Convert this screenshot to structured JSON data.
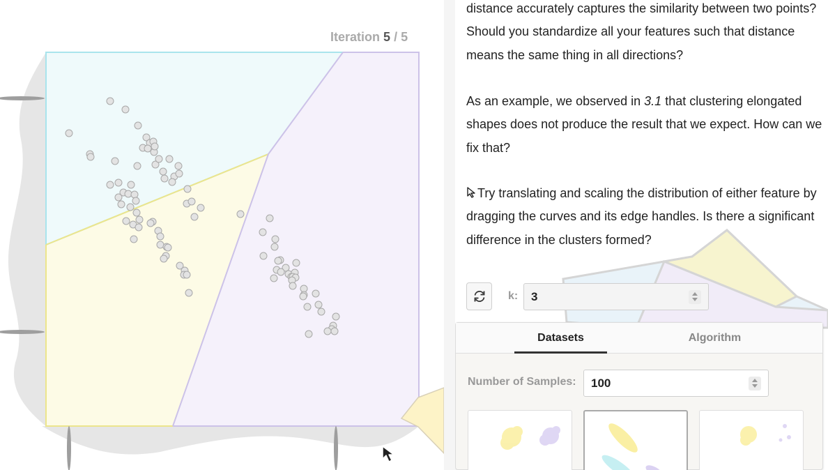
{
  "iteration": {
    "prefix": "Iteration",
    "current": "5",
    "separator": "/",
    "total": "5"
  },
  "article": {
    "para1": "distance accurately captures the similarity between two points? Should you standardize all your features such that distance means the same thing in all directions?",
    "para2_before": "As an example, we observed in",
    "para2_ref": "3.1",
    "para2_after": "that clustering elongated shapes does not produce the result that we expect. How can we fix that?",
    "para3": "Try translating and scaling the distribution of either feature by dragging the curves and its edge handles. Is there a significant difference in the clusters formed?"
  },
  "controls": {
    "k_label": "k:",
    "k_value": "3"
  },
  "tabs": [
    {
      "label": "Datasets"
    },
    {
      "label": "Algorithm"
    }
  ],
  "datasets_panel": {
    "samples_label": "Number of Samples:",
    "samples_value": "100"
  },
  "clusters": [
    {
      "name": "cyan",
      "fill": "#effafb",
      "stroke": "#a9e4ec"
    },
    {
      "name": "yellow",
      "fill": "#fdfbe6",
      "stroke": "#ece58c"
    },
    {
      "name": "lavender",
      "fill": "#f5f1fb",
      "stroke": "#ccc2e8"
    }
  ],
  "colors": {
    "point_fill": "#e3e3e3",
    "point_stroke": "#a8a8a8",
    "density_fill": "#e6e6e6",
    "accent_dark": "#333333"
  },
  "icons": {
    "refresh": "refresh-icon",
    "cursor": "cursor-icon"
  },
  "samples": [
    [
      158,
      145
    ],
    [
      180,
      157
    ],
    [
      99,
      191
    ],
    [
      198,
      180
    ],
    [
      129,
      221
    ],
    [
      130,
      225
    ],
    [
      210,
      197
    ],
    [
      215,
      205
    ],
    [
      220,
      203
    ],
    [
      205,
      212
    ],
    [
      212,
      213
    ],
    [
      221,
      218
    ],
    [
      222,
      210
    ],
    [
      165,
      231
    ],
    [
      197,
      238
    ],
    [
      223,
      236
    ],
    [
      228,
      228
    ],
    [
      243,
      228
    ],
    [
      256,
      238
    ],
    [
      234,
      246
    ],
    [
      250,
      253
    ],
    [
      257,
      249
    ],
    [
      247,
      261
    ],
    [
      236,
      256
    ],
    [
      158,
      265
    ],
    [
      170,
      262
    ],
    [
      188,
      265
    ],
    [
      177,
      276
    ],
    [
      184,
      278
    ],
    [
      193,
      279
    ],
    [
      170,
      283
    ],
    [
      195,
      288
    ],
    [
      174,
      293
    ],
    [
      187,
      297
    ],
    [
      269,
      271
    ],
    [
      268,
      292
    ],
    [
      275,
      289
    ],
    [
      288,
      298
    ],
    [
      279,
      311
    ],
    [
      345,
      307
    ],
    [
      196,
      305
    ],
    [
      200,
      315
    ],
    [
      181,
      317
    ],
    [
      191,
      322
    ],
    [
      199,
      326
    ],
    [
      219,
      318
    ],
    [
      216,
      320
    ],
    [
      227,
      331
    ],
    [
      230,
      339
    ],
    [
      230,
      351
    ],
    [
      239,
      354
    ],
    [
      241,
      355
    ],
    [
      238,
      367
    ],
    [
      235,
      371
    ],
    [
      192,
      343
    ],
    [
      258,
      381
    ],
    [
      265,
      388
    ],
    [
      264,
      394
    ],
    [
      268,
      394
    ],
    [
      271,
      420
    ],
    [
      387,
      313
    ],
    [
      377,
      333
    ],
    [
      395,
      343
    ],
    [
      394,
      354
    ],
    [
      378,
      367
    ],
    [
      402,
      373
    ],
    [
      399,
      374
    ],
    [
      410,
      384
    ],
    [
      425,
      377
    ],
    [
      397,
      387
    ],
    [
      403,
      390
    ],
    [
      414,
      393
    ],
    [
      418,
      397
    ],
    [
      423,
      391
    ],
    [
      420,
      397
    ],
    [
      424,
      398
    ],
    [
      419,
      402
    ],
    [
      393,
      399
    ],
    [
      420,
      410
    ],
    [
      436,
      414
    ],
    [
      436,
      423
    ],
    [
      435,
      425
    ],
    [
      453,
      421
    ],
    [
      457,
      437
    ],
    [
      441,
      440
    ],
    [
      461,
      447
    ],
    [
      482,
      454
    ],
    [
      478,
      467
    ],
    [
      476,
      472
    ],
    [
      470,
      475
    ],
    [
      480,
      475
    ],
    [
      443,
      479
    ]
  ]
}
